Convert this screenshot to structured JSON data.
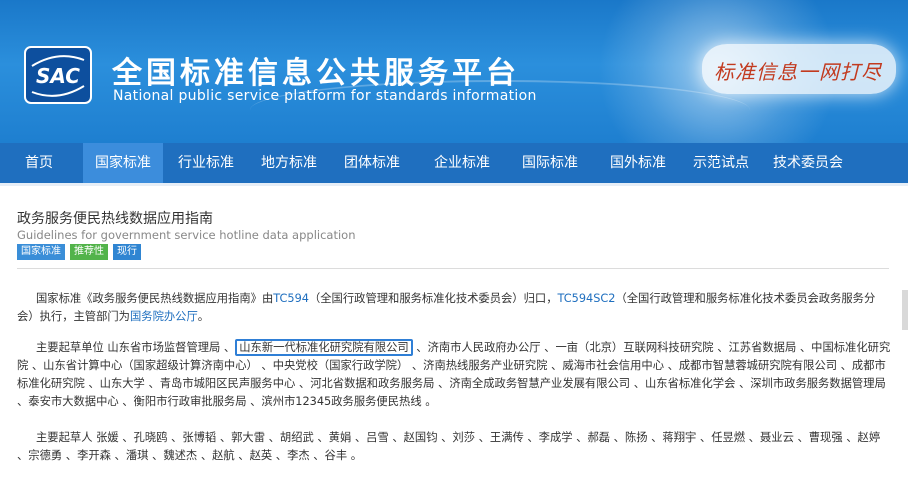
{
  "header": {
    "logo_text": "SAC",
    "title": "全国标准信息公共服务平台",
    "subtitle": "National public service platform  for standards information",
    "slogan": "标准信息一网打尽"
  },
  "nav": {
    "items": [
      "首页",
      "国家标准",
      "行业标准",
      "地方标准",
      "团体标准",
      "企业标准",
      "国际标准",
      "国外标准",
      "示范试点",
      "技术委员会"
    ],
    "active_index": 1
  },
  "standard": {
    "title": "政务服务便民热线数据应用指南",
    "title_en": "Guidelines for government service hotline data application",
    "tags": [
      "国家标准",
      "推荐性",
      "现行"
    ]
  },
  "intro": {
    "part1": "国家标准《政务服务便民热线数据应用指南》由",
    "tc1": "TC594",
    "part2": "（全国行政管理和服务标准化技术委员会）归口，",
    "tc2": "TC594SC2",
    "part3": "（全国行政管理和服务标准化技术委员会政务服务分会）执行，主管部门为",
    "dept": "国务院办公厅",
    "part4": "。"
  },
  "drafting_units": {
    "label": "主要起草单位 ",
    "before": "山东省市场监督管理局 、",
    "highlighted": "山东新一代标准化研究院有限公司",
    "after": " 、济南市人民政府办公厅 、一亩（北京）互联网科技研究院 、江苏省数据局 、中国标准化研究院 、山东省计算中心（国家超级计算济南中心） 、中央党校（国家行政学院） 、济南热线服务产业研究院 、威海市社会信用中心 、成都市智慧蓉城研究院有限公司 、成都市标准化研究院 、山东大学 、青岛市城阳区民声服务中心 、河北省数据和政务服务局 、济南全成政务智慧产业发展有限公司 、山东省标准化学会 、深圳市政务服务数据管理局 、泰安市大数据中心 、衡阳市行政审批服务局 、滨州市12345政务服务便民热线 。"
  },
  "drafters": {
    "label": "主要起草人 ",
    "names": "张媛 、孔晓鸥 、张博韬 、郭大雷 、胡绍武 、黄娟 、吕雪 、赵国钧 、刘莎 、王满传 、李成学 、郝磊 、陈扬 、蒋翔宇 、任昱燃 、聂业云 、曹现强 、赵婷 、宗德勇 、李开森 、潘琪 、魏述杰 、赵航 、赵英 、李杰 、谷丰 。"
  },
  "colors": {
    "header_blue": "#2b8fdc",
    "nav_blue": "#1f6fbf",
    "nav_active": "#3c8ddc",
    "link": "#1f6fbf",
    "tag_green": "#52b34a"
  }
}
